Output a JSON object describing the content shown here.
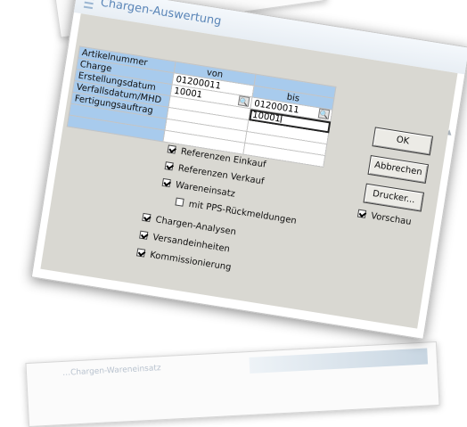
{
  "background": {
    "bottom_sheet_text": "…Chargen-Wareneinsatz"
  },
  "window": {
    "title": "Chargen-Auswertung",
    "icon": "app-icon"
  },
  "grid": {
    "col_von": "von",
    "col_bis": "bis",
    "rows": [
      {
        "label": "Artikelnummer",
        "von": "",
        "bis": ""
      },
      {
        "label": "Charge",
        "von": "01200011",
        "bis": ""
      },
      {
        "label": "Erstellungsdatum",
        "von": "10001",
        "bis": "01200011"
      },
      {
        "label": "Verfallsdatum/MHD",
        "von": "",
        "bis": "10001"
      },
      {
        "label": "Fertigungsauftrag",
        "von": "",
        "bis": ""
      }
    ]
  },
  "buttons": {
    "ok": "OK",
    "cancel": "Abbrechen",
    "printer": "Drucker..."
  },
  "preview": {
    "label": "Vorschau",
    "checked": true
  },
  "checkboxes": [
    {
      "label": "Referenzen Einkauf",
      "checked": true
    },
    {
      "label": "Referenzen Verkauf",
      "checked": true
    },
    {
      "label": "Wareneinsatz",
      "checked": true
    },
    {
      "label": "mit PPS-Rückmeldungen",
      "checked": false
    },
    {
      "label": "Chargen-Analysen",
      "checked": true
    },
    {
      "label": "Versandeinheiten",
      "checked": true
    },
    {
      "label": "Kommissionierung",
      "checked": true
    }
  ],
  "colors": {
    "header_blue": "#a8cbed",
    "dialog_gray": "#d9d8d2",
    "title_blue": "#5b86b8"
  }
}
